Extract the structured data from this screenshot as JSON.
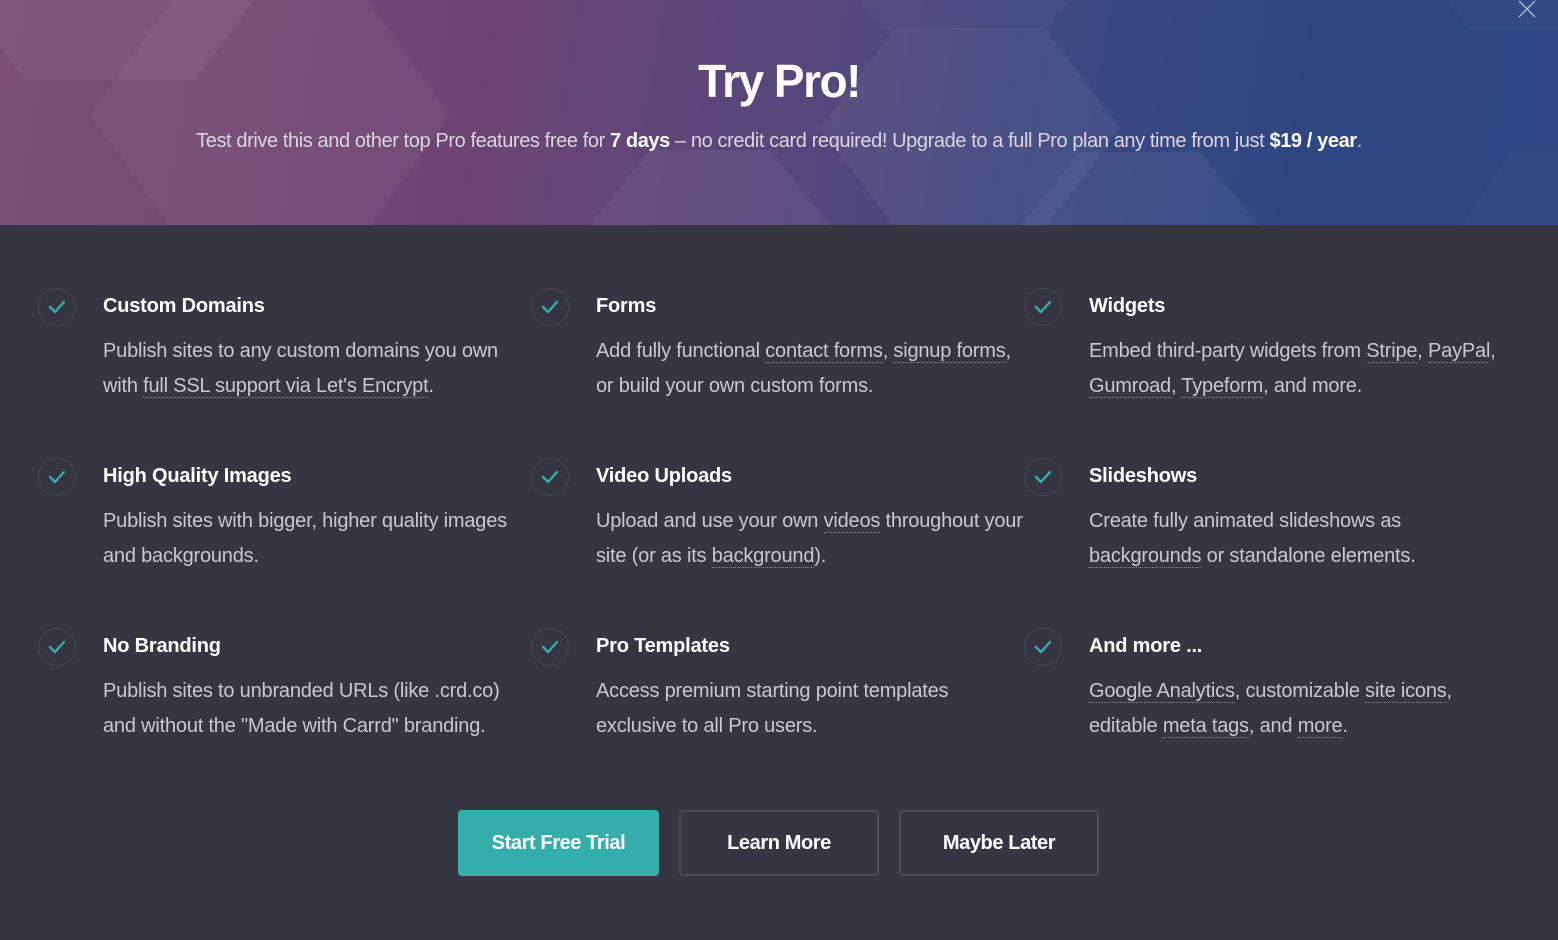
{
  "header": {
    "title": "Try Pro!",
    "subtitle_pre": "Test drive this and other top Pro features free for ",
    "subtitle_bold1": "7 days",
    "subtitle_mid": " – no credit card required! Upgrade to a full Pro plan any time from just ",
    "subtitle_bold2": "$19 / year",
    "subtitle_post": ".",
    "close_icon": "close-icon"
  },
  "colors": {
    "accent": "#33aeaa",
    "body_bg": "#363642",
    "header_gradient_start": "#7a4f78",
    "header_gradient_end": "#2b4585"
  },
  "features": [
    {
      "icon": "check-icon",
      "title": "Custom Domains",
      "desc": [
        {
          "t": "Publish sites to any custom domains you own with "
        },
        {
          "t": "full SSL support via Let's Encrypt",
          "link": true
        },
        {
          "t": "."
        }
      ]
    },
    {
      "icon": "check-icon",
      "title": "Forms",
      "desc": [
        {
          "t": "Add fully functional "
        },
        {
          "t": "contact forms",
          "link": true
        },
        {
          "t": ", "
        },
        {
          "t": "signup forms",
          "link": true
        },
        {
          "t": ", or build your own custom forms."
        }
      ]
    },
    {
      "icon": "check-icon",
      "title": "Widgets",
      "desc": [
        {
          "t": "Embed third-party widgets from "
        },
        {
          "t": "Stripe",
          "link": true
        },
        {
          "t": ", "
        },
        {
          "t": "PayPal",
          "link": true
        },
        {
          "t": ", "
        },
        {
          "t": "Gumroad",
          "link": true
        },
        {
          "t": ", "
        },
        {
          "t": "Typeform",
          "link": true
        },
        {
          "t": ", and more."
        }
      ]
    },
    {
      "icon": "check-icon",
      "title": "High Quality Images",
      "desc": [
        {
          "t": "Publish sites with bigger, higher quality images and backgrounds."
        }
      ]
    },
    {
      "icon": "check-icon",
      "title": "Video Uploads",
      "desc": [
        {
          "t": "Upload and use your own "
        },
        {
          "t": "videos",
          "link": true
        },
        {
          "t": " throughout your site (or as its "
        },
        {
          "t": "background",
          "link": true
        },
        {
          "t": ")."
        }
      ]
    },
    {
      "icon": "check-icon",
      "title": "Slideshows",
      "desc": [
        {
          "t": "Create fully animated slideshows as "
        },
        {
          "t": "backgrounds",
          "link": true
        },
        {
          "t": " or standalone elements."
        }
      ]
    },
    {
      "icon": "check-icon",
      "title": "No Branding",
      "desc": [
        {
          "t": "Publish sites to unbranded URLs (like .crd.co) and without the \"Made with Carrd\" branding."
        }
      ]
    },
    {
      "icon": "check-icon",
      "title": "Pro Templates",
      "desc": [
        {
          "t": "Access premium starting point templates exclusive to all Pro users."
        }
      ]
    },
    {
      "icon": "check-icon",
      "title": "And more ...",
      "desc": [
        {
          "t": "Google Analytics",
          "link": true
        },
        {
          "t": ", customizable "
        },
        {
          "t": "site icons",
          "link": true
        },
        {
          "t": ", editable "
        },
        {
          "t": "meta tags",
          "link": true
        },
        {
          "t": ", and "
        },
        {
          "t": "more",
          "link": true
        },
        {
          "t": "."
        }
      ]
    }
  ],
  "buttons": {
    "start_trial": "Start Free Trial",
    "learn_more": "Learn More",
    "maybe_later": "Maybe Later"
  }
}
